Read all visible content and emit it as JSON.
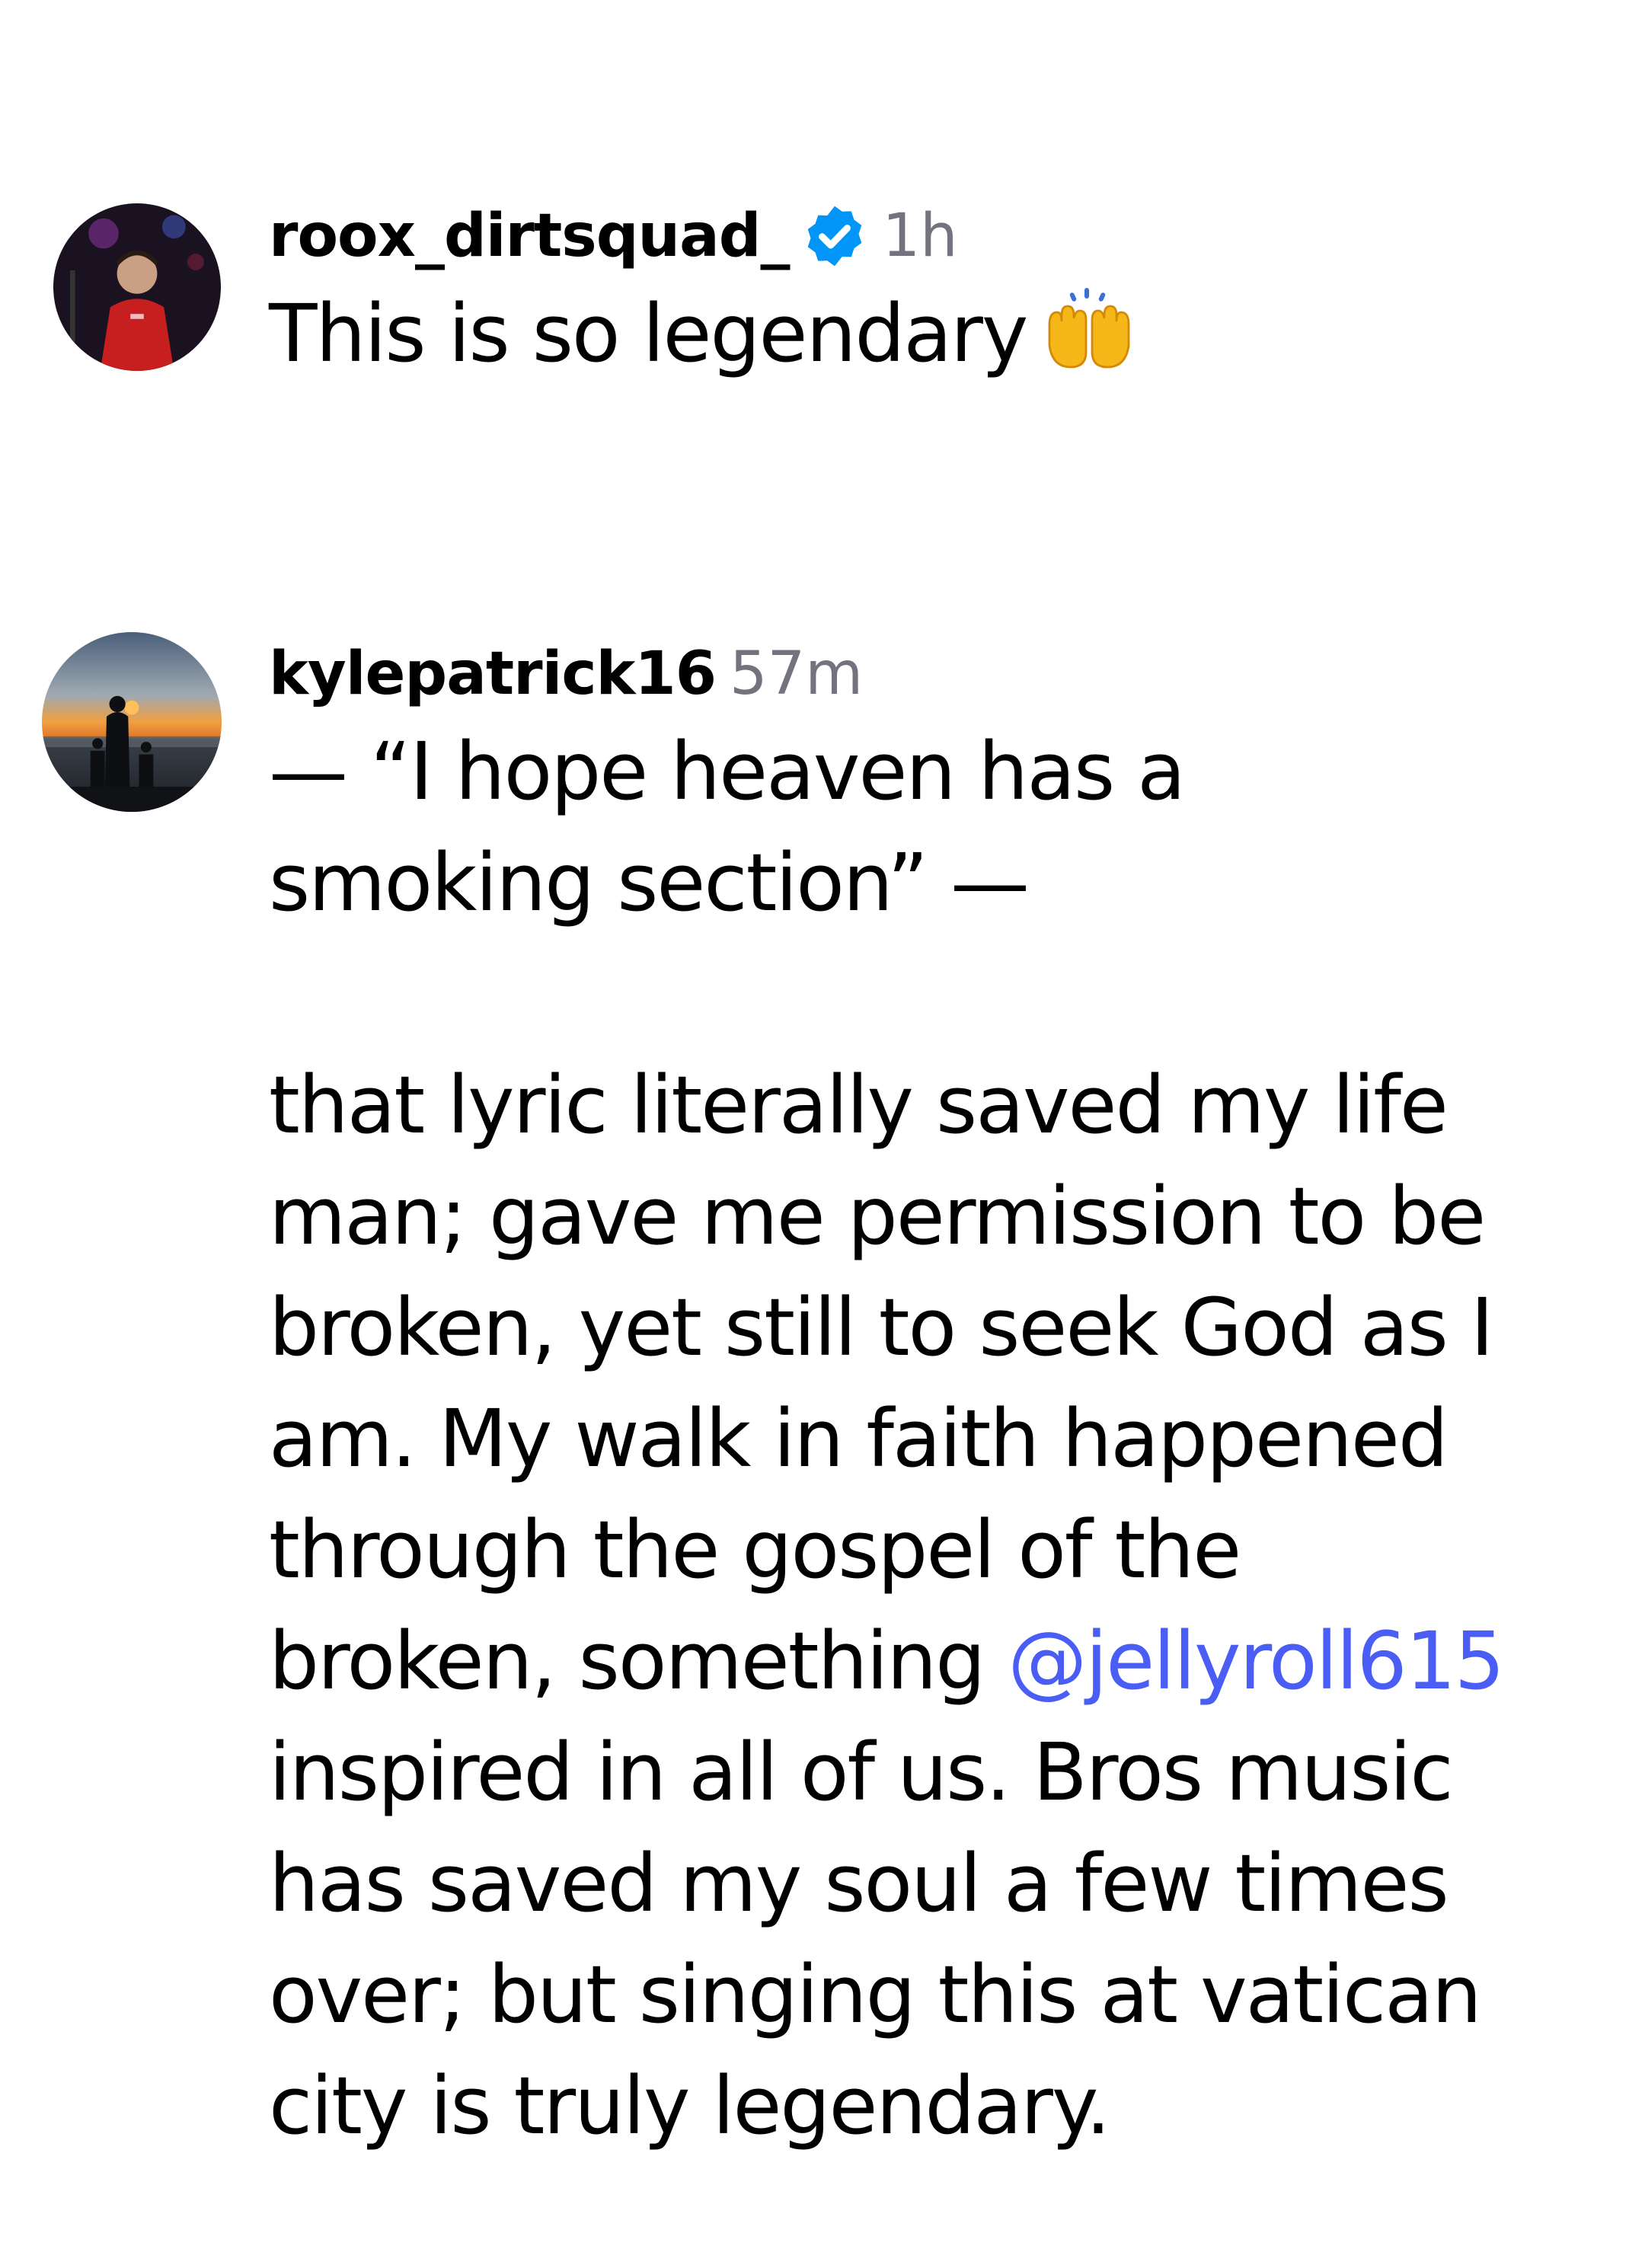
{
  "comments": [
    {
      "username": "roox_dirtsquad_",
      "verified": true,
      "timestamp": "1h",
      "text": "This is so legendary",
      "emoji": "raising-hands-emoji"
    },
    {
      "username": "kylepatrick16",
      "verified": false,
      "timestamp": "57m",
      "text_part1": "— “I hope heaven has a\nsmoking section” —\n\nthat lyric literally saved my life\nman; gave me permission to be\nbroken, yet still to seek God as I\nam. My walk in faith happened\nthrough the gospel of the\nbroken, something ",
      "mention": "@jellyroll615",
      "text_part2": "\ninspired in all of us. Bros music\nhas saved my soul a few times\nover; but singing this at vatican\ncity is truly legendary."
    }
  ],
  "colors": {
    "text": "#000000",
    "timestamp": "#73737f",
    "mention": "#4a5df5",
    "verified_badge": "#0095f6"
  }
}
